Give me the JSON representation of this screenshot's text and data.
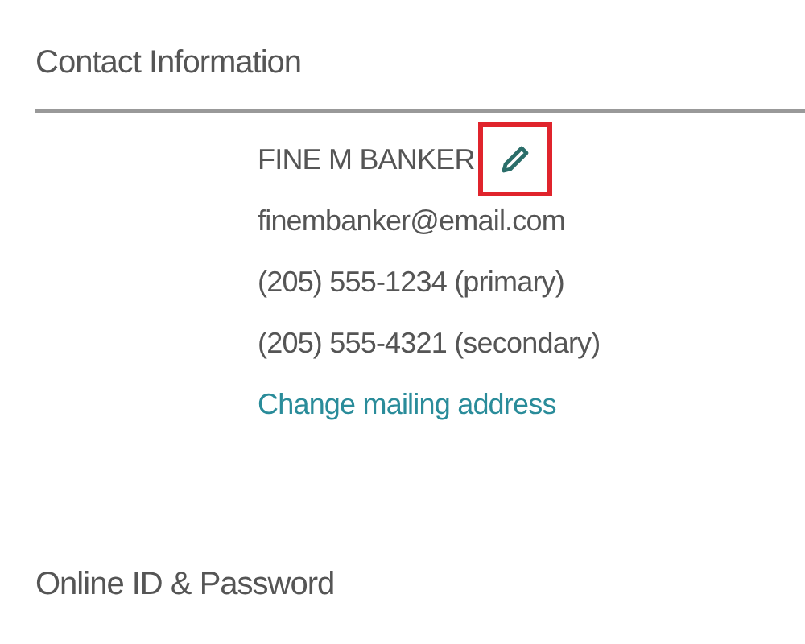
{
  "section": {
    "title": "Contact Information"
  },
  "contact": {
    "name": "FINE M BANKER",
    "edit_highlighted": true,
    "lines": [
      "finembanker@email.com",
      "(205) 555-1234 (primary)",
      "(205) 555-4321 (secondary)"
    ],
    "link": "Change mailing address"
  },
  "next_section": {
    "title": "Online ID & Password"
  }
}
